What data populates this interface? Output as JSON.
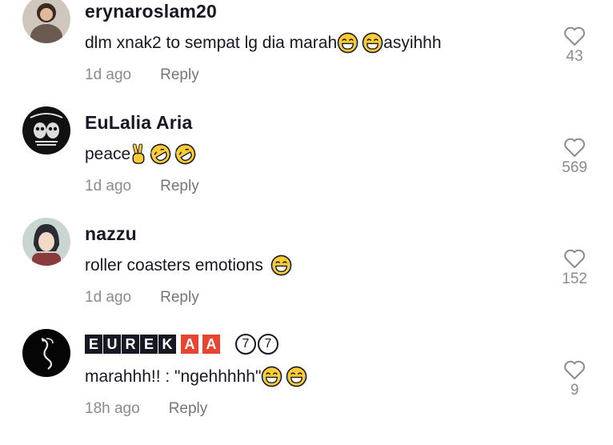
{
  "comments": [
    {
      "username": "erynaroslam20",
      "text_before": "dlm xnak2 to sempat lg dia marah",
      "text_after": "asyihhh",
      "time": "1d ago",
      "reply_label": "Reply",
      "likes": "43"
    },
    {
      "username": "EuLalia Aria",
      "text_before": "peace",
      "time": "1d ago",
      "reply_label": "Reply",
      "likes": "569"
    },
    {
      "username": "nazzu",
      "text_before": "roller coasters emotions",
      "time": "1d ago",
      "reply_label": "Reply",
      "likes": "152"
    },
    {
      "username_letters": [
        "E",
        "U",
        "R",
        "E",
        "K"
      ],
      "username_red_letters": [
        "A",
        "A"
      ],
      "username_circled": [
        "7",
        "7"
      ],
      "text_before": "marahhh!! : \"ngehhhhh\"",
      "time": "18h ago",
      "reply_label": "Reply",
      "likes": "9"
    }
  ],
  "icons": {
    "like": "heart-outline-icon",
    "laugh": "face-with-tears-of-joy-emoji",
    "rofl": "rolling-on-floor-laughing-emoji",
    "peace": "victory-hand-emoji"
  },
  "colors": {
    "text": "#161823",
    "muted": "#8a8b91",
    "accent_red": "#e8442f"
  }
}
